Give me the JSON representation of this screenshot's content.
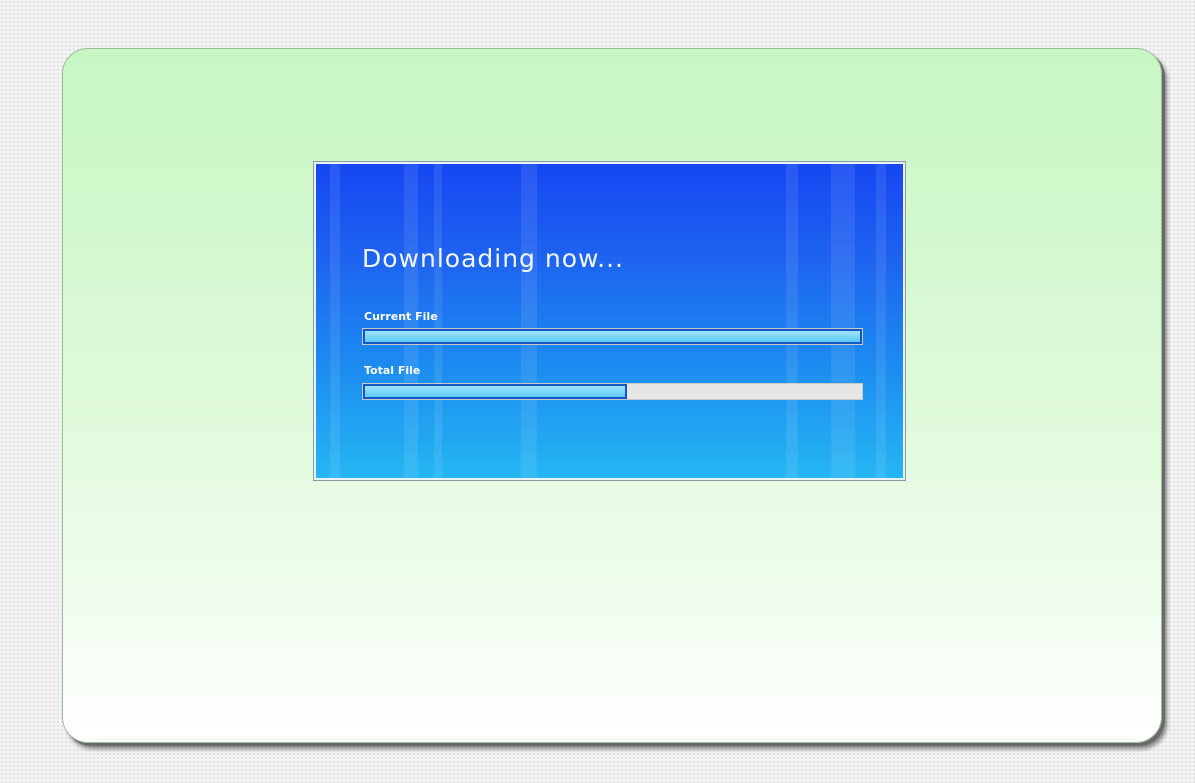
{
  "dialog": {
    "title": "Downloading now...",
    "current_file": {
      "label": "Current File",
      "progress_percent": 100
    },
    "total_file": {
      "label": "Total File",
      "progress_percent": 53
    }
  },
  "colors": {
    "card_top": "#c8f7c4",
    "card_bottom": "#ffffff",
    "panel_top": "#1547f2",
    "panel_bottom": "#25b6f3",
    "bar_fill": "#5ccaf7",
    "bar_track": "#e6e6e6"
  }
}
